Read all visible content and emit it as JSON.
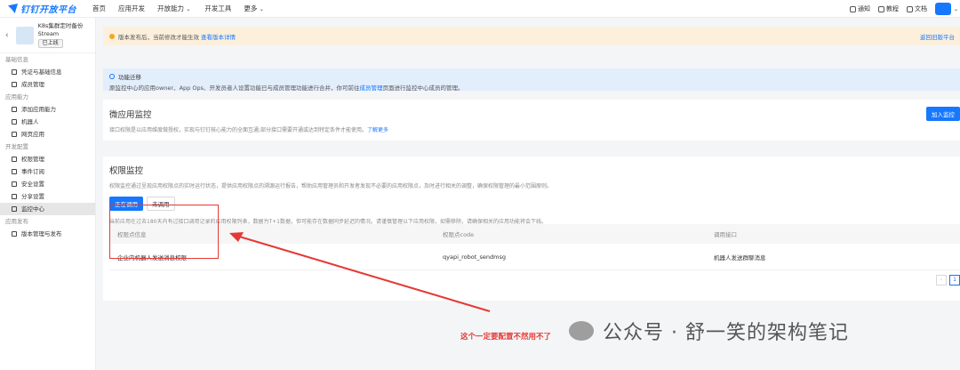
{
  "topnav": {
    "logo": "钉钉开放平台",
    "items": [
      "首页",
      "应用开发",
      "开放能力",
      "开发工具",
      "更多"
    ],
    "right": [
      "通知",
      "教程",
      "文档"
    ]
  },
  "sidebar": {
    "app_name": "K8s集群定时备份",
    "app_type": "Stream",
    "app_status": "已上线",
    "groups": [
      {
        "title": "基础信息",
        "items": [
          "凭证与基础信息",
          "成员管理"
        ]
      },
      {
        "title": "应用能力",
        "items": [
          "添加应用能力",
          "机器人",
          "网页应用"
        ]
      },
      {
        "title": "开发配置",
        "items": [
          "权限管理",
          "事件订阅",
          "安全设置",
          "分享设置",
          "监控中心"
        ]
      },
      {
        "title": "应用发布",
        "items": [
          "版本管理与发布"
        ]
      }
    ],
    "active": "监控中心"
  },
  "notice": {
    "text": "版本发布后，当前修改才能生效",
    "link": "查看版本详情",
    "right_link": "返回旧版平台"
  },
  "info": {
    "title": "功能迁移",
    "text_before": "原监控中心的应用owner、App Ops、开发员者人设置功能已与成员管理功能进行合并，你可前往",
    "link": "成员管理",
    "text_after": "页面进行监控中心成员的管理。"
  },
  "micro_monitor": {
    "title": "微应用监控",
    "desc": "接口权限是以应用维度做授权，实现与钉钉核心能力的全面互通;部分接口需要开通或达到特定条件才能使用。",
    "link": "了解更多",
    "add_button": "加入监控"
  },
  "perm_monitor": {
    "title": "权限监控",
    "desc": "权限监控通过呈现应用权限点的实时运行状态，提供应用权限点的溯源运行报告，帮助应用管理员和开发者发现不必要的应用权限点，及时进行相关的调整，确保权限管理的最小范围原则。",
    "tabs": [
      "正在调用",
      "未调用"
    ],
    "hint": "当前应用在过去180天内有过接口调用记录的应用权限列表，数据为T+1数据，但可能存在数据同步延迟的情况。请谨慎管理以下应用权限，如需移除，请确保相关的应用功能将会下线。",
    "columns": [
      "权限点信息",
      "权限点code",
      "调用接口"
    ],
    "rows": [
      {
        "name": "企业内机器人发送消息权限",
        "code": "qyapi_robot_sendmsg",
        "api": "机器人发送群聊消息"
      }
    ],
    "page": "1"
  },
  "annotation": "这个一定要配置不然用不了",
  "watermark": "公众号 · 舒一笑的架构笔记"
}
